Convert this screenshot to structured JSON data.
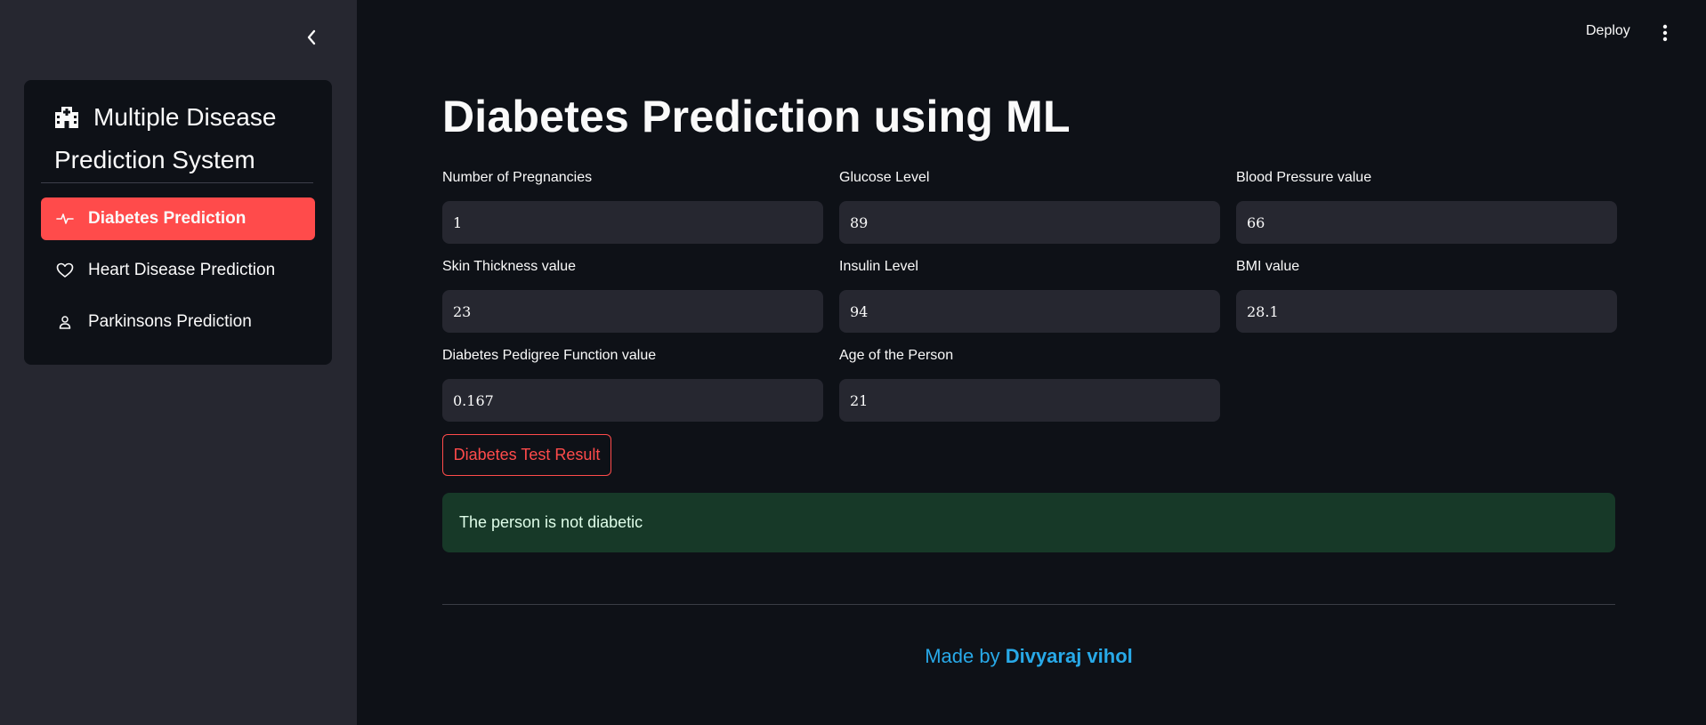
{
  "sidebar": {
    "collapse_icon": "chevron-left-icon",
    "menu_title": "Multiple Disease Prediction System",
    "items": [
      {
        "label": "Diabetes Prediction",
        "icon": "activity-icon",
        "active": true
      },
      {
        "label": "Heart Disease Prediction",
        "icon": "heart-icon",
        "active": false
      },
      {
        "label": "Parkinsons Prediction",
        "icon": "person-icon",
        "active": false
      }
    ]
  },
  "header": {
    "deploy_label": "Deploy",
    "menu_icon": "kebab-menu-icon"
  },
  "main": {
    "title": "Diabetes Prediction using ML",
    "fields": [
      {
        "label": "Number of Pregnancies",
        "value": "1"
      },
      {
        "label": "Glucose Level",
        "value": "89"
      },
      {
        "label": "Blood Pressure value",
        "value": "66"
      },
      {
        "label": "Skin Thickness value",
        "value": "23"
      },
      {
        "label": "Insulin Level",
        "value": "94"
      },
      {
        "label": "BMI value",
        "value": "28.1"
      },
      {
        "label": "Diabetes Pedigree Function value",
        "value": "0.167"
      },
      {
        "label": "Age of the Person",
        "value": "21"
      }
    ],
    "button_label": "Diabetes Test Result",
    "result_text": "The person is not diabetic"
  },
  "footer": {
    "prefix": "Made by ",
    "author": "Divyaraj vihol"
  },
  "colors": {
    "accent": "#ff4b4b",
    "background": "#0e1117",
    "sidebar": "#262730",
    "success_bg": "#173928",
    "link": "#28a9e8"
  }
}
